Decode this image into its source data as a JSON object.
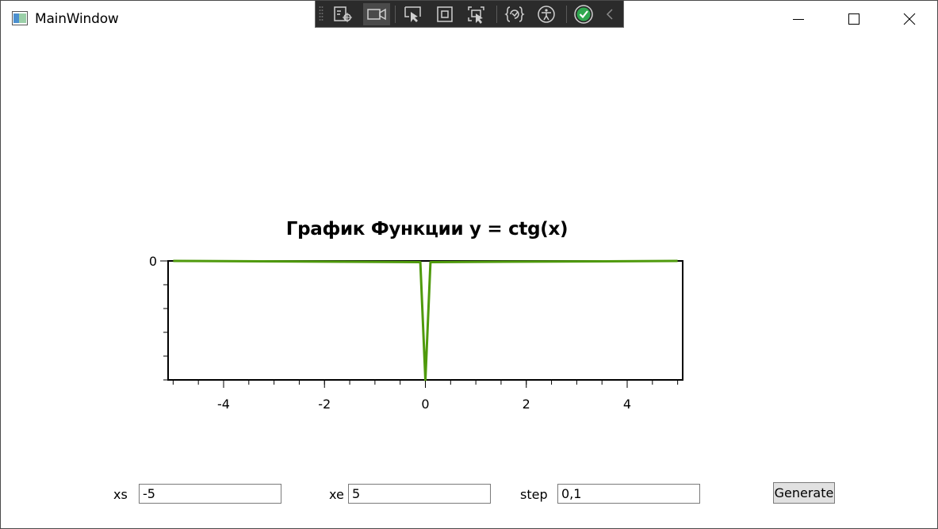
{
  "window": {
    "title": "MainWindow"
  },
  "colors": {
    "series": "#4f9a0c",
    "devbar_bg": "#2b2b2b",
    "check_green": "#2fa84f"
  },
  "devtools": {
    "icons": [
      "visual-tree-icon",
      "record-icon",
      "select-element-icon",
      "display-layout-adorners-icon",
      "track-focus-icon",
      "hot-reload-icon",
      "accessibility-icon",
      "binding-check-icon",
      "collapse-icon"
    ]
  },
  "chart_data": {
    "type": "line",
    "title": "График Функции y = ctg(x)",
    "xlabel": "",
    "ylabel": "",
    "xlim": [
      -5.1,
      5.1
    ],
    "ylim": [
      -1000,
      0
    ],
    "x_ticks": [
      -4,
      -2,
      0,
      2,
      4
    ],
    "x_tick_labels": [
      "-4",
      "-2",
      "0",
      "2",
      "4"
    ],
    "y_ticks": [
      0
    ],
    "y_tick_labels": [
      "0"
    ],
    "grid": false,
    "series": [
      {
        "x": [
          -5,
          -0.1,
          0,
          0.1,
          5
        ],
        "y": [
          0,
          -10,
          -1000,
          -10,
          0
        ]
      }
    ]
  },
  "form": {
    "xs_label": "xs",
    "xs_value": "-5",
    "xe_label": "xe",
    "xe_value": "5",
    "step_label": "step",
    "step_value": "0,1",
    "generate_label": "Generate"
  }
}
